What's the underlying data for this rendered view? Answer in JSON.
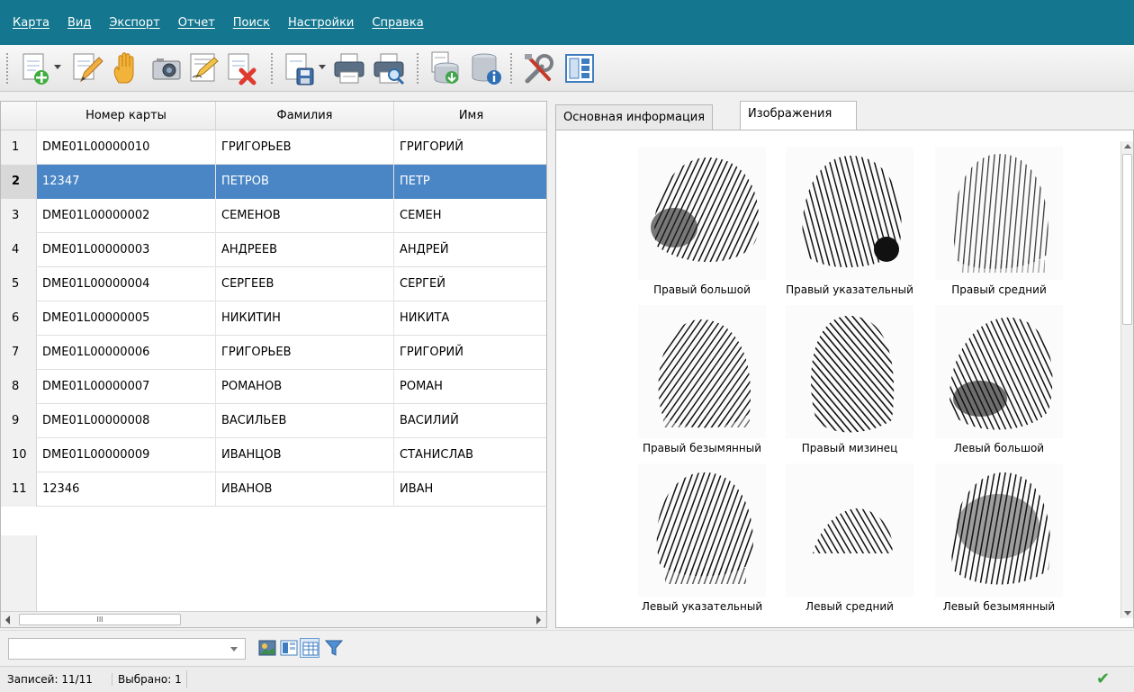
{
  "menu": {
    "items": [
      {
        "label": "Карта"
      },
      {
        "label": "Вид"
      },
      {
        "label": "Экспорт"
      },
      {
        "label": "Отчет"
      },
      {
        "label": "Поиск"
      },
      {
        "label": "Настройки"
      },
      {
        "label": "Справка"
      }
    ]
  },
  "toolbar": {
    "icons": [
      "new-card-icon",
      "edit-card-icon",
      "hand-icon",
      "camera-icon",
      "sign-document-icon",
      "delete-card-icon",
      "save-icon",
      "print-icon",
      "print-preview-icon",
      "database-import-icon",
      "database-info-icon",
      "tools-icon",
      "layout-icon"
    ]
  },
  "table": {
    "columns": [
      "Номер карты",
      "Фамилия",
      "Имя"
    ],
    "selected_row": 2,
    "rows": [
      {
        "n": "1",
        "card": "DME01L00000010",
        "last": "ГРИГОРЬЕВ",
        "first": "ГРИГОРИЙ"
      },
      {
        "n": "2",
        "card": "12347",
        "last": "ПЕТРОВ",
        "first": "ПЕТР"
      },
      {
        "n": "3",
        "card": "DME01L00000002",
        "last": "СЕМЕНОВ",
        "first": "СЕМЕН"
      },
      {
        "n": "4",
        "card": "DME01L00000003",
        "last": "АНДРЕЕВ",
        "first": "АНДРЕЙ"
      },
      {
        "n": "5",
        "card": "DME01L00000004",
        "last": "СЕРГЕЕВ",
        "first": "СЕРГЕЙ"
      },
      {
        "n": "6",
        "card": "DME01L00000005",
        "last": "НИКИТИН",
        "first": "НИКИТА"
      },
      {
        "n": "7",
        "card": "DME01L00000006",
        "last": "ГРИГОРЬЕВ",
        "first": "ГРИГОРИЙ"
      },
      {
        "n": "8",
        "card": "DME01L00000007",
        "last": "РОМАНОВ",
        "first": "РОМАН"
      },
      {
        "n": "9",
        "card": "DME01L00000008",
        "last": "ВАСИЛЬЕВ",
        "first": "ВАСИЛИЙ"
      },
      {
        "n": "10",
        "card": "DME01L00000009",
        "last": "ИВАНЦОВ",
        "first": "СТАНИСЛАВ"
      },
      {
        "n": "11",
        "card": "12346",
        "last": "ИВАНОВ",
        "first": "ИВАН"
      }
    ],
    "hscroll_grip": "III"
  },
  "tabs": [
    {
      "label": "Основная информация",
      "active": false
    },
    {
      "label": "Изображения",
      "active": true
    }
  ],
  "fingerprints": [
    {
      "label": "Правый большой"
    },
    {
      "label": "Правый указательный"
    },
    {
      "label": "Правый средний"
    },
    {
      "label": "Правый безымянный"
    },
    {
      "label": "Правый мизинец"
    },
    {
      "label": "Левый большой"
    },
    {
      "label": "Левый указательный"
    },
    {
      "label": "Левый средний"
    },
    {
      "label": "Левый безымянный"
    }
  ],
  "bottombar": {
    "combo_value": "",
    "icons": [
      "photo-view-icon",
      "split-view-icon",
      "grid-view-icon",
      "filter-icon"
    ]
  },
  "status": {
    "records": "Записей: 11/11",
    "selected": "Выбрано: 1",
    "ok_icon": "checkmark-icon",
    "ok_glyph": "✔"
  },
  "colors": {
    "menubar": "#14778f",
    "selection": "#4a86c6"
  }
}
